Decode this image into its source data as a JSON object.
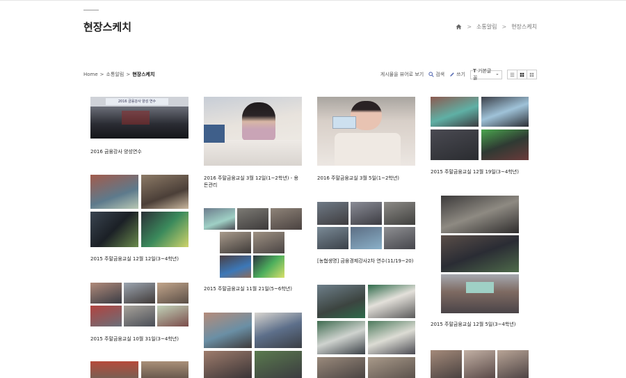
{
  "header": {
    "title": "현장스케치"
  },
  "top_breadcrumb": {
    "items": [
      "소통알림",
      "현장스케치"
    ],
    "separator": ">"
  },
  "sub_breadcrumb": {
    "home": "Home",
    "section": "소통알림",
    "current": "현장스케치",
    "separator": ">"
  },
  "toolbar": {
    "view_posts": "게시물을 뷰어로 보기",
    "search": "검색",
    "write": "쓰기",
    "font_select": "기본글꼴",
    "font_prefix": "T"
  },
  "posts": [
    {
      "caption": "2016 금융강사 양성연수",
      "banner": "2016 금융강사 양성 연수"
    },
    {
      "caption": "2016 주말금융교실 3월 12일(1~2학년) - 용돈관리"
    },
    {
      "caption": "2016 주말금융교실 3월 5일(1~2학년)"
    },
    {
      "caption": "2015 주말금융교실 12월 19일(3~4학년)"
    },
    {
      "caption": "2015 주말금융교실 12월 12일(3~4학년)"
    },
    {
      "caption": "2015 주말금융교실 11월 21일(5~6학년)"
    },
    {
      "caption": "[농협생명] 금융경제강사2차 연수(11/19~20)"
    },
    {
      "caption": "2015 주말금융교실 12월 5일(3~4학년)"
    },
    {
      "caption": "2015 주말금융교실 10월 31일(3~4학년)"
    }
  ],
  "colors": {
    "accent_icon": "#5b6fb5",
    "text": "#222222",
    "border": "#cccccc"
  }
}
